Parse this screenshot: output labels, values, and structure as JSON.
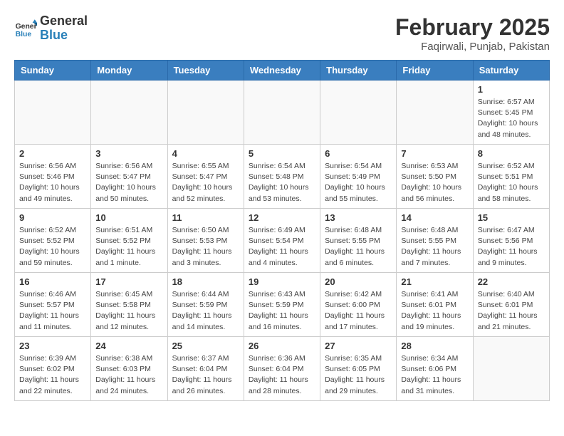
{
  "header": {
    "logo_general": "General",
    "logo_blue": "Blue",
    "month_year": "February 2025",
    "location": "Faqirwali, Punjab, Pakistan"
  },
  "weekdays": [
    "Sunday",
    "Monday",
    "Tuesday",
    "Wednesday",
    "Thursday",
    "Friday",
    "Saturday"
  ],
  "weeks": [
    [
      {
        "day": "",
        "info": ""
      },
      {
        "day": "",
        "info": ""
      },
      {
        "day": "",
        "info": ""
      },
      {
        "day": "",
        "info": ""
      },
      {
        "day": "",
        "info": ""
      },
      {
        "day": "",
        "info": ""
      },
      {
        "day": "1",
        "info": "Sunrise: 6:57 AM\nSunset: 5:45 PM\nDaylight: 10 hours and 48 minutes."
      }
    ],
    [
      {
        "day": "2",
        "info": "Sunrise: 6:56 AM\nSunset: 5:46 PM\nDaylight: 10 hours and 49 minutes."
      },
      {
        "day": "3",
        "info": "Sunrise: 6:56 AM\nSunset: 5:47 PM\nDaylight: 10 hours and 50 minutes."
      },
      {
        "day": "4",
        "info": "Sunrise: 6:55 AM\nSunset: 5:47 PM\nDaylight: 10 hours and 52 minutes."
      },
      {
        "day": "5",
        "info": "Sunrise: 6:54 AM\nSunset: 5:48 PM\nDaylight: 10 hours and 53 minutes."
      },
      {
        "day": "6",
        "info": "Sunrise: 6:54 AM\nSunset: 5:49 PM\nDaylight: 10 hours and 55 minutes."
      },
      {
        "day": "7",
        "info": "Sunrise: 6:53 AM\nSunset: 5:50 PM\nDaylight: 10 hours and 56 minutes."
      },
      {
        "day": "8",
        "info": "Sunrise: 6:52 AM\nSunset: 5:51 PM\nDaylight: 10 hours and 58 minutes."
      }
    ],
    [
      {
        "day": "9",
        "info": "Sunrise: 6:52 AM\nSunset: 5:52 PM\nDaylight: 10 hours and 59 minutes."
      },
      {
        "day": "10",
        "info": "Sunrise: 6:51 AM\nSunset: 5:52 PM\nDaylight: 11 hours and 1 minute."
      },
      {
        "day": "11",
        "info": "Sunrise: 6:50 AM\nSunset: 5:53 PM\nDaylight: 11 hours and 3 minutes."
      },
      {
        "day": "12",
        "info": "Sunrise: 6:49 AM\nSunset: 5:54 PM\nDaylight: 11 hours and 4 minutes."
      },
      {
        "day": "13",
        "info": "Sunrise: 6:48 AM\nSunset: 5:55 PM\nDaylight: 11 hours and 6 minutes."
      },
      {
        "day": "14",
        "info": "Sunrise: 6:48 AM\nSunset: 5:55 PM\nDaylight: 11 hours and 7 minutes."
      },
      {
        "day": "15",
        "info": "Sunrise: 6:47 AM\nSunset: 5:56 PM\nDaylight: 11 hours and 9 minutes."
      }
    ],
    [
      {
        "day": "16",
        "info": "Sunrise: 6:46 AM\nSunset: 5:57 PM\nDaylight: 11 hours and 11 minutes."
      },
      {
        "day": "17",
        "info": "Sunrise: 6:45 AM\nSunset: 5:58 PM\nDaylight: 11 hours and 12 minutes."
      },
      {
        "day": "18",
        "info": "Sunrise: 6:44 AM\nSunset: 5:59 PM\nDaylight: 11 hours and 14 minutes."
      },
      {
        "day": "19",
        "info": "Sunrise: 6:43 AM\nSunset: 5:59 PM\nDaylight: 11 hours and 16 minutes."
      },
      {
        "day": "20",
        "info": "Sunrise: 6:42 AM\nSunset: 6:00 PM\nDaylight: 11 hours and 17 minutes."
      },
      {
        "day": "21",
        "info": "Sunrise: 6:41 AM\nSunset: 6:01 PM\nDaylight: 11 hours and 19 minutes."
      },
      {
        "day": "22",
        "info": "Sunrise: 6:40 AM\nSunset: 6:01 PM\nDaylight: 11 hours and 21 minutes."
      }
    ],
    [
      {
        "day": "23",
        "info": "Sunrise: 6:39 AM\nSunset: 6:02 PM\nDaylight: 11 hours and 22 minutes."
      },
      {
        "day": "24",
        "info": "Sunrise: 6:38 AM\nSunset: 6:03 PM\nDaylight: 11 hours and 24 minutes."
      },
      {
        "day": "25",
        "info": "Sunrise: 6:37 AM\nSunset: 6:04 PM\nDaylight: 11 hours and 26 minutes."
      },
      {
        "day": "26",
        "info": "Sunrise: 6:36 AM\nSunset: 6:04 PM\nDaylight: 11 hours and 28 minutes."
      },
      {
        "day": "27",
        "info": "Sunrise: 6:35 AM\nSunset: 6:05 PM\nDaylight: 11 hours and 29 minutes."
      },
      {
        "day": "28",
        "info": "Sunrise: 6:34 AM\nSunset: 6:06 PM\nDaylight: 11 hours and 31 minutes."
      },
      {
        "day": "",
        "info": ""
      }
    ]
  ]
}
